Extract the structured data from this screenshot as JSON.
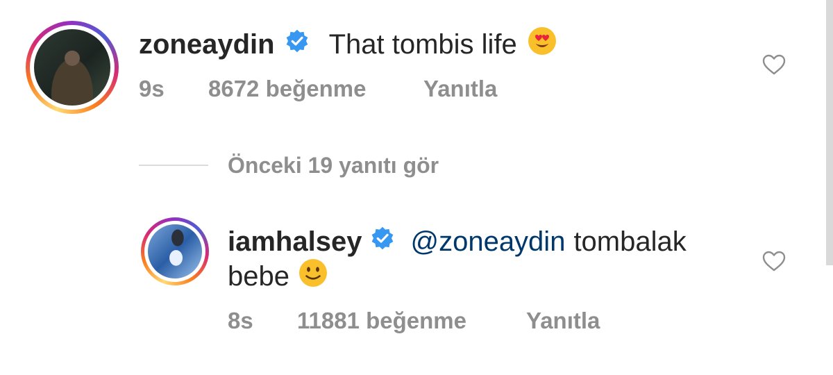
{
  "comments": [
    {
      "username": "zoneaydin",
      "text": "That tombis life",
      "emoji": "😍",
      "time": "9s",
      "likes": "8672 beğenme",
      "reply": "Yanıtla"
    },
    {
      "username": "iamhalsey",
      "mention": "@zoneaydin",
      "text_line1": "tombalak",
      "text_line2": "bebe",
      "emoji": "🙂",
      "time": "8s",
      "likes": "11881 beğenme",
      "reply": "Yanıtla"
    }
  ],
  "view_previous_replies": "Önceki 19 yanıtı gör",
  "icons": {
    "verified": "verified-badge-icon",
    "like": "heart-outline-icon"
  },
  "colors": {
    "text": "#262626",
    "meta": "#8e8e8e",
    "mention": "#00376b",
    "verified": "#3897f0"
  }
}
